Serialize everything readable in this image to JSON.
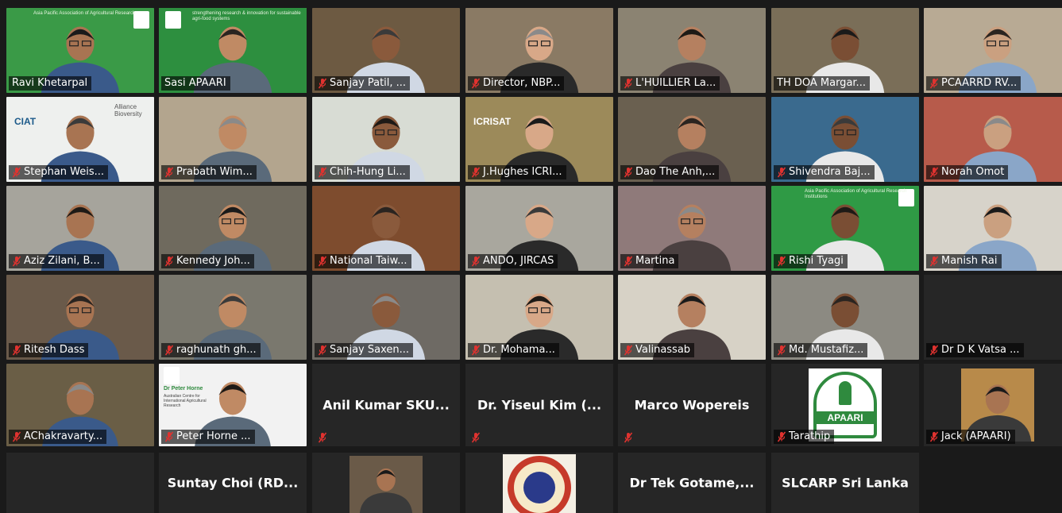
{
  "meeting": {
    "colors": {
      "background": "#1a1a1a",
      "tile_dark": "#262626",
      "speaker_outline": "#e5e545",
      "mute_icon": "#e0322f",
      "apaari_green": "#2f9a45"
    },
    "row1": [
      {
        "name": "Ravi Khetarpal",
        "muted": false,
        "banner": "Asia Pacific Association of Agricultural Research",
        "bg": "#3a9a47"
      },
      {
        "name": "Sasi APAARI",
        "muted": false,
        "speaking": true,
        "banner": "strengthening research & innovation for sustainable agri-food systems",
        "bg": "#2d8f3f"
      },
      {
        "name": "Sanjay Patil, ...",
        "muted": true,
        "bg": "#6d5a42"
      },
      {
        "name": "Director, NBP...",
        "muted": true,
        "bg": "#8a7a64"
      },
      {
        "name": "L'HUILLIER La...",
        "muted": true,
        "bg": "#8b8372"
      },
      {
        "name": "TH DOA Margar...",
        "muted": false,
        "bg": "#7a6e58"
      },
      {
        "name": "PCAARRD RV...",
        "muted": true,
        "bg": "#b8aa94"
      }
    ],
    "row2": [
      {
        "name": "Stephan Weis...",
        "muted": true,
        "bg": "#eef0ee",
        "logo_text": "CIAT",
        "alliance_text": "Alliance Bioversity"
      },
      {
        "name": "Prabath Wim...",
        "muted": true,
        "bg": "#b3a58e"
      },
      {
        "name": "Chih-Hung Li...",
        "muted": true,
        "bg": "#d8dcd4"
      },
      {
        "name": "J.Hughes ICRI...",
        "muted": true,
        "bg": "#9c8a5a",
        "logo_text": "ICRISAT"
      },
      {
        "name": "Dao The Anh,...",
        "muted": true,
        "bg": "#6a6050"
      },
      {
        "name": "Shivendra Baj...",
        "muted": true,
        "bg": "#3a6a8e"
      },
      {
        "name": "Norah Omot",
        "muted": true,
        "bg": "#b75b4b"
      }
    ],
    "row3": [
      {
        "name": "Aziz Zilani, B...",
        "muted": true,
        "bg": "#a6a49c"
      },
      {
        "name": "Kennedy Joh...",
        "muted": true,
        "bg": "#6f6a5e"
      },
      {
        "name": "National Taiw...",
        "muted": true,
        "bg": "#7e4c2e"
      },
      {
        "name": "ANDO, JIRCAS",
        "muted": true,
        "bg": "#a9a79e"
      },
      {
        "name": "Martina",
        "muted": true,
        "bg": "#8f7a7a"
      },
      {
        "name": "Rishi Tyagi",
        "muted": true,
        "bg": "#2f9a45",
        "banner": "Asia Pacific Association of Agricultural Research Institutions"
      },
      {
        "name": "Manish Rai",
        "muted": true,
        "bg": "#d7d3ca"
      }
    ],
    "row4": [
      {
        "name": "Ritesh Dass",
        "muted": true,
        "bg": "#6a5a4a"
      },
      {
        "name": "raghunath gh...",
        "muted": true,
        "bg": "#7a786e"
      },
      {
        "name": "Sanjay Saxen...",
        "muted": true,
        "bg": "#6e6a64"
      },
      {
        "name": "Dr. Mohama...",
        "muted": true,
        "bg": "#c5bfb0"
      },
      {
        "name": "Valinassab",
        "muted": true,
        "bg": "#d7d2c6"
      },
      {
        "name": "Md. Mustafiz...",
        "muted": true,
        "bg": "#8c8a82"
      },
      {
        "name": "Dr D K Vatsa ...",
        "muted": true,
        "dark": true
      }
    ],
    "row5": [
      {
        "name": "AChakravarty...",
        "muted": true,
        "bg": "#6a5e46"
      },
      {
        "name": "Peter Horne ...",
        "muted": true,
        "bg": "#f2f2f2",
        "slide_title": "Dr Peter Horne",
        "slide_sub": "Australian Centre for International Agricultural Research"
      },
      {
        "name": "Anil Kumar SKU...",
        "muted": true,
        "dark": true,
        "show_center": true
      },
      {
        "name": "Dr. Yiseul Kim (...",
        "muted": true,
        "dark": true,
        "show_center": true
      },
      {
        "name": "Marco Wopereis",
        "muted": true,
        "dark": true,
        "show_center": true
      },
      {
        "name": "Tarathip",
        "muted": true,
        "dark": true,
        "logo": "APAARI"
      },
      {
        "name": "Jack (APAARI)",
        "muted": true,
        "dark": true,
        "photo": true
      }
    ],
    "row6": [
      {
        "name": "Suntay Choi (RD...",
        "muted": false,
        "dark": true,
        "show_center": true
      },
      {
        "name": "",
        "muted": false,
        "dark": true,
        "photo": true
      },
      {
        "name": "",
        "muted": false,
        "dark": true,
        "emblem": true
      },
      {
        "name": "Dr Tek Gotame,...",
        "muted": false,
        "dark": true,
        "show_center": true
      },
      {
        "name": "SLCARP Sri Lanka",
        "muted": false,
        "dark": true,
        "show_center": true
      }
    ]
  }
}
